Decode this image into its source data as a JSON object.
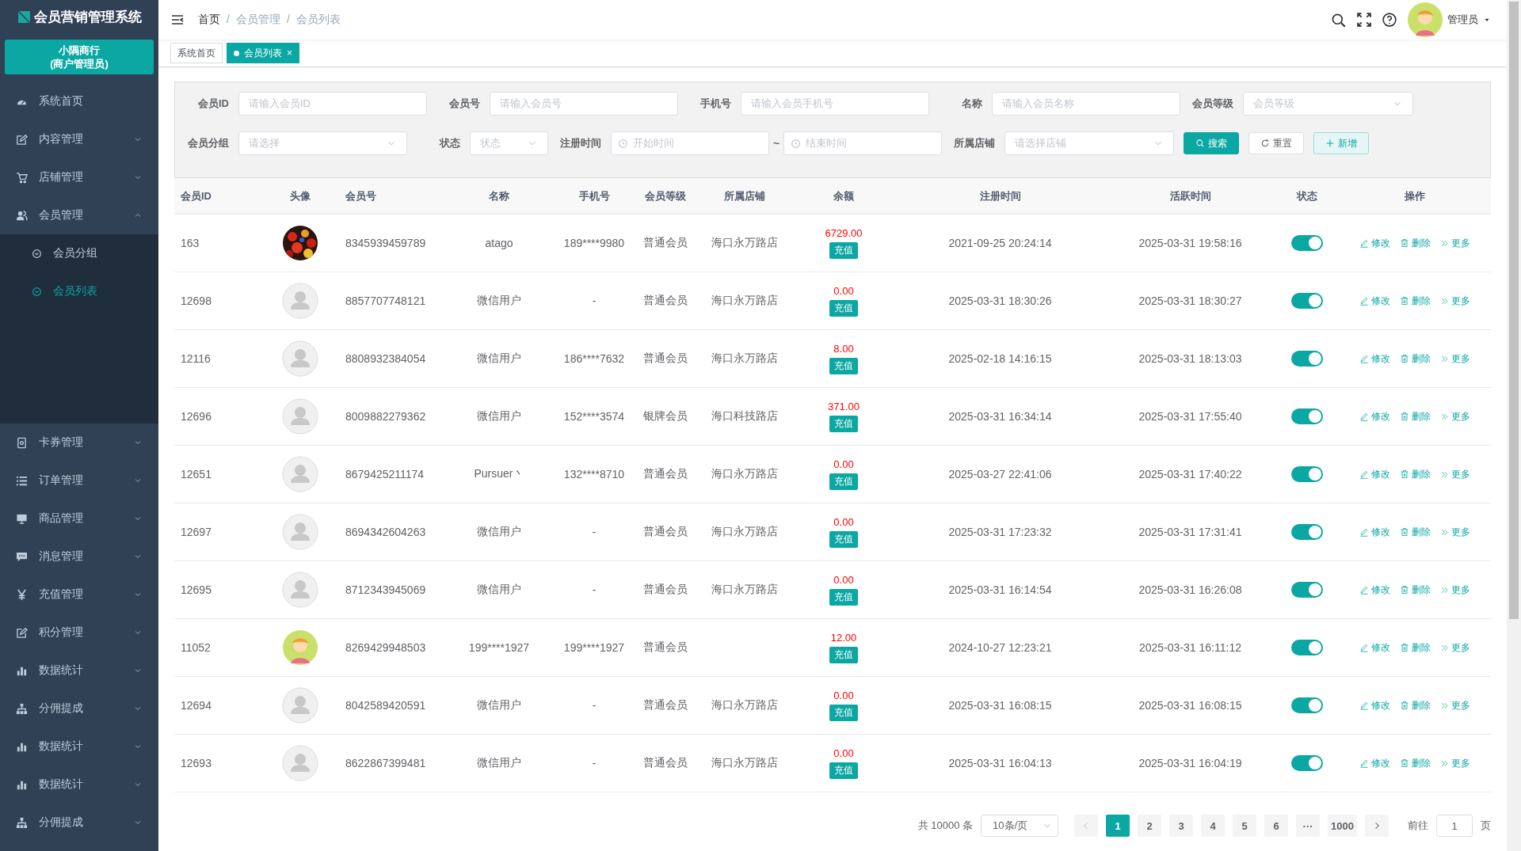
{
  "app": {
    "title": "会员营销管理系统",
    "merchant": "小隅商行",
    "role": "(商户管理员)"
  },
  "sidebar": {
    "items": [
      {
        "label": "系统首页",
        "expandable": false
      },
      {
        "label": "内容管理",
        "expandable": true,
        "expanded": false
      },
      {
        "label": "店铺管理",
        "expandable": true,
        "expanded": false
      },
      {
        "label": "会员管理",
        "expandable": true,
        "expanded": true,
        "children": [
          {
            "label": "会员分组",
            "selected": false
          },
          {
            "label": "会员列表",
            "selected": true
          }
        ]
      },
      {
        "label": "卡券管理",
        "expandable": true,
        "expanded": false
      },
      {
        "label": "订单管理",
        "expandable": true,
        "expanded": false
      },
      {
        "label": "商品管理",
        "expandable": true,
        "expanded": false
      },
      {
        "label": "消息管理",
        "expandable": true,
        "expanded": false
      },
      {
        "label": "充值管理",
        "expandable": true,
        "expanded": false
      },
      {
        "label": "积分管理",
        "expandable": true,
        "expanded": false
      },
      {
        "label": "数据统计",
        "expandable": true,
        "expanded": false
      },
      {
        "label": "分佣提成",
        "expandable": true,
        "expanded": false
      },
      {
        "label": "数据统计",
        "expandable": true,
        "expanded": false
      },
      {
        "label": "数据统计",
        "expandable": true,
        "expanded": false
      },
      {
        "label": "分佣提成",
        "expandable": true,
        "expanded": false
      }
    ]
  },
  "breadcrumb": [
    {
      "label": "首页"
    },
    {
      "separator": "/",
      "label": "会员管理"
    },
    {
      "separator": "/",
      "label": "会员列表"
    }
  ],
  "user": {
    "name": "管理员"
  },
  "tabs": [
    {
      "label": "系统首页",
      "selected": false,
      "closable": false
    },
    {
      "label": "会员列表",
      "selected": true,
      "closable": true,
      "close": "×"
    }
  ],
  "filters": [
    [
      {
        "kind": "input",
        "label": "会员ID",
        "placeholder": "请输入会员ID"
      },
      {
        "kind": "input",
        "label": "会员号",
        "placeholder": "请输入会员号"
      },
      {
        "kind": "input",
        "label": "手机号",
        "placeholder": "请输入会员手机号"
      },
      {
        "kind": "input",
        "label": "名称",
        "placeholder": "请输入会员名称"
      },
      {
        "kind": "select",
        "label": "会员等级",
        "placeholder": "会员等级"
      }
    ],
    [
      {
        "kind": "select",
        "label": "会员分组",
        "placeholder": "请选择"
      },
      {
        "kind": "select",
        "label": "状态",
        "placeholder": "状态"
      },
      {
        "kind": "daterange",
        "label": "注册时间",
        "placeholder": "开始时间",
        "placeholder_end": "结束时间",
        "separator": "~"
      },
      {
        "kind": "select",
        "label": "所属店铺",
        "placeholder": "请选择店铺"
      }
    ]
  ],
  "filter_buttons": [
    {
      "kind": "primary",
      "label": "搜索"
    },
    {
      "kind": "default",
      "label": "重置"
    },
    {
      "kind": "light",
      "label": "新增"
    }
  ],
  "table": {
    "columns": [
      "会员ID",
      "头像",
      "会员号",
      "名称",
      "手机号",
      "会员等级",
      "所属店铺",
      "余额",
      "注册时间",
      "活跃时间",
      "状态",
      "操作"
    ],
    "rows": [
      {
        "id": "163",
        "kind": "picture",
        "member_no": "8345939459789",
        "name": "atago",
        "phone": "189****9980",
        "level": "普通会员",
        "store": "海口永万路店",
        "balance": "6729.00",
        "recharge": "充值",
        "registered": "2021-09-25 20:24:14",
        "active": "2025-03-31 19:58:16",
        "enabled": true,
        "actions": [
          "修改",
          "删除",
          "更多"
        ]
      },
      {
        "id": "12698",
        "kind": "default",
        "member_no": "8857707748121",
        "name": "微信用户",
        "phone": "-",
        "level": "普通会员",
        "store": "海口永万路店",
        "balance": "0.00",
        "recharge": "充值",
        "registered": "2025-03-31 18:30:26",
        "active": "2025-03-31 18:30:27",
        "enabled": true,
        "actions": [
          "修改",
          "删除",
          "更多"
        ]
      },
      {
        "id": "12116",
        "kind": "default",
        "member_no": "8808932384054",
        "name": "微信用户",
        "phone": "186****7632",
        "level": "普通会员",
        "store": "海口永万路店",
        "balance": "8.00",
        "recharge": "充值",
        "registered": "2025-02-18 14:16:15",
        "active": "2025-03-31 18:13:03",
        "enabled": true,
        "actions": [
          "修改",
          "删除",
          "更多"
        ]
      },
      {
        "id": "12696",
        "kind": "default",
        "member_no": "8009882279362",
        "name": "微信用户",
        "phone": "152****3574",
        "level": "银牌会员",
        "store": "海口科技路店",
        "balance": "371.00",
        "recharge": "充值",
        "registered": "2025-03-31 16:34:14",
        "active": "2025-03-31 17:55:40",
        "enabled": true,
        "actions": [
          "修改",
          "删除",
          "更多"
        ]
      },
      {
        "id": "12651",
        "kind": "default",
        "member_no": "8679425211174",
        "name": "Pursuer丶",
        "phone": "132****8710",
        "level": "普通会员",
        "store": "海口永万路店",
        "balance": "0.00",
        "recharge": "充值",
        "registered": "2025-03-27 22:41:06",
        "active": "2025-03-31 17:40:22",
        "enabled": true,
        "actions": [
          "修改",
          "删除",
          "更多"
        ]
      },
      {
        "id": "12697",
        "kind": "default",
        "member_no": "8694342604263",
        "name": "微信用户",
        "phone": "-",
        "level": "普通会员",
        "store": "海口永万路店",
        "balance": "0.00",
        "recharge": "充值",
        "registered": "2025-03-31 17:23:32",
        "active": "2025-03-31 17:31:41",
        "enabled": true,
        "actions": [
          "修改",
          "删除",
          "更多"
        ]
      },
      {
        "id": "12695",
        "kind": "default",
        "member_no": "8712343945069",
        "name": "微信用户",
        "phone": "-",
        "level": "普通会员",
        "store": "海口永万路店",
        "balance": "0.00",
        "recharge": "充值",
        "registered": "2025-03-31 16:14:54",
        "active": "2025-03-31 16:26:08",
        "enabled": true,
        "actions": [
          "修改",
          "删除",
          "更多"
        ]
      },
      {
        "id": "11052",
        "kind": "cartoon",
        "member_no": "8269429948503",
        "name": "199****1927",
        "phone": "199****1927",
        "level": "普通会员",
        "balance": "12.00",
        "recharge": "充值",
        "registered": "2024-10-27 12:23:21",
        "active": "2025-03-31 16:11:12",
        "enabled": true,
        "actions": [
          "修改",
          "删除",
          "更多"
        ]
      },
      {
        "id": "12694",
        "kind": "default",
        "member_no": "8042589420591",
        "name": "微信用户",
        "phone": "-",
        "level": "普通会员",
        "store": "海口永万路店",
        "balance": "0.00",
        "recharge": "充值",
        "registered": "2025-03-31 16:08:15",
        "active": "2025-03-31 16:08:15",
        "enabled": true,
        "actions": [
          "修改",
          "删除",
          "更多"
        ]
      },
      {
        "id": "12693",
        "kind": "default",
        "member_no": "8622867399481",
        "name": "微信用户",
        "phone": "-",
        "level": "普通会员",
        "store": "海口永万路店",
        "balance": "0.00",
        "recharge": "充值",
        "registered": "2025-03-31 16:04:13",
        "active": "2025-03-31 16:04:19",
        "enabled": true,
        "actions": [
          "修改",
          "删除",
          "更多"
        ]
      }
    ]
  },
  "pagination": {
    "total": "共 10000 条",
    "page_size": "10条/页",
    "pages": [
      {
        "label": "1",
        "selected": true
      },
      {
        "label": "2",
        "selected": false
      },
      {
        "label": "3",
        "selected": false
      },
      {
        "label": "4",
        "selected": false
      },
      {
        "label": "5",
        "selected": false
      },
      {
        "label": "6",
        "selected": false
      },
      {
        "label": "···",
        "selected": false
      },
      {
        "label": "1000",
        "selected": false
      }
    ],
    "prev_disabled": true,
    "goto_label": "前往",
    "goto_value": "1",
    "goto_suffix": "页"
  }
}
